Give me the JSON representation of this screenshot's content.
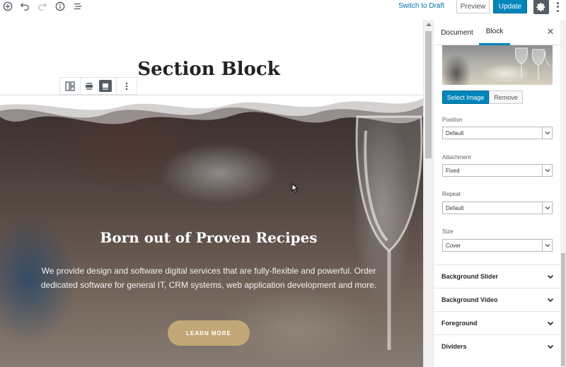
{
  "toolbar": {
    "add_icon": "plus-circle-icon",
    "undo_icon": "undo-icon",
    "redo_icon": "redo-icon",
    "info_icon": "info-icon",
    "outline_icon": "list-icon",
    "switch_to_draft": "Switch to Draft",
    "preview": "Preview",
    "update": "Update",
    "settings_icon": "gear-icon",
    "more_icon": "more-vertical-icon",
    "accent": "#0085ba"
  },
  "editor": {
    "title": "Section Block",
    "block_toolbar": {
      "layout_icon": "layout-icon",
      "wide_icon": "align-wide-icon",
      "full_icon": "align-full-icon",
      "more_icon": "more-vertical-icon"
    },
    "hero": {
      "heading": "Born out of Proven Recipes",
      "text": "We provide design and  software digital services that are fully-flexible and powerful. Order dedicated software for general IT, CRM systems, web application  development and more.",
      "button": "LEARN MORE",
      "button_color": "#c2a878"
    }
  },
  "sidebar": {
    "tabs": [
      {
        "label": "Document",
        "active": false
      },
      {
        "label": "Block",
        "active": true
      }
    ],
    "close_icon": "close-icon",
    "select_image": "Select Image",
    "remove": "Remove",
    "fields": [
      {
        "label": "Position",
        "value": "Default"
      },
      {
        "label": "Attachment",
        "value": "Fixed"
      },
      {
        "label": "Repeat",
        "value": "Default"
      },
      {
        "label": "Size",
        "value": "Cover"
      }
    ],
    "panels": [
      {
        "label": "Background Slider"
      },
      {
        "label": "Background Video"
      },
      {
        "label": "Foreground"
      },
      {
        "label": "Dividers"
      }
    ]
  }
}
